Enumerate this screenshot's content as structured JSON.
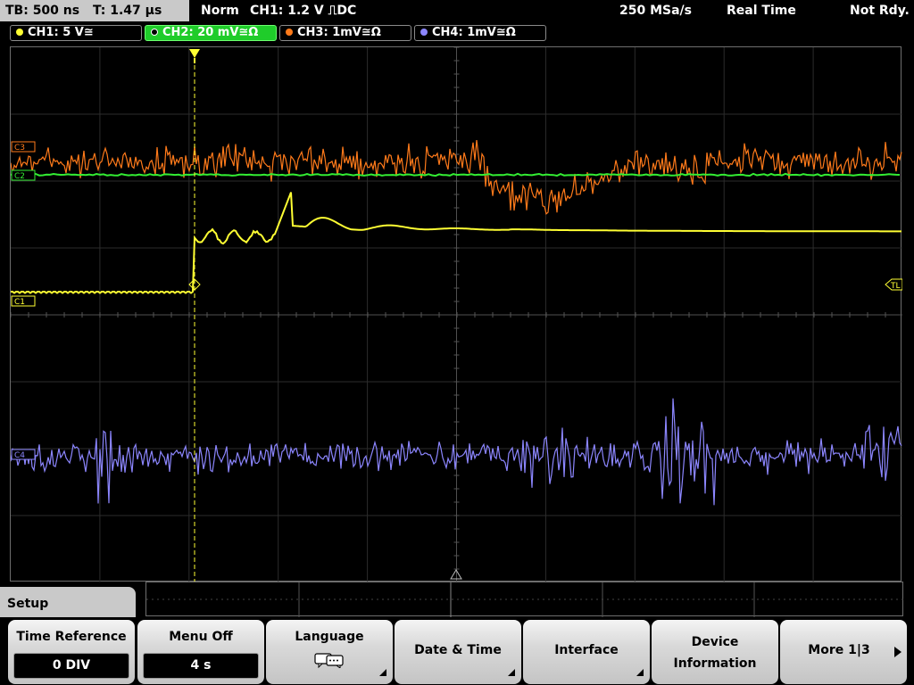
{
  "status": {
    "timebase": "TB: 500 ns",
    "trigger_pos": "T: 1.47 µs",
    "mode": "Norm",
    "trigger_info": "CH1: 1.2 V ⎍DC",
    "sample_rate": "250 MSa/s",
    "acq_mode": "Real Time",
    "state": "Not Rdy."
  },
  "channels": [
    {
      "label": "CH1: 5 V≅",
      "color": "#ffff33",
      "active": false
    },
    {
      "label": "CH2: 20 mV≅Ω",
      "color": "#33ee33",
      "active": true
    },
    {
      "label": "CH3: 1mV≅Ω",
      "color": "#ff7a1a",
      "active": false
    },
    {
      "label": "CH4: 1mV≅Ω",
      "color": "#8c86ff",
      "active": false
    }
  ],
  "markers": {
    "c1": "C1",
    "c2": "C2",
    "c3": "C3",
    "c4": "C4",
    "tl": "TL"
  },
  "setup_tab": "Setup",
  "menu": {
    "time_reference": {
      "label": "Time Reference",
      "value": "0 DIV"
    },
    "menu_off": {
      "label": "Menu Off",
      "value": "4 s"
    },
    "language": {
      "label": "Language"
    },
    "date_time": {
      "label": "Date & Time"
    },
    "interface": {
      "label": "Interface"
    },
    "device_info": {
      "line1": "Device",
      "line2": "Information"
    },
    "more": {
      "label": "More 1|3"
    }
  },
  "icons": {
    "language": "speech-bubbles-icon",
    "more": "triangle-right-icon",
    "submenu": "corner-triangle-icon"
  }
}
